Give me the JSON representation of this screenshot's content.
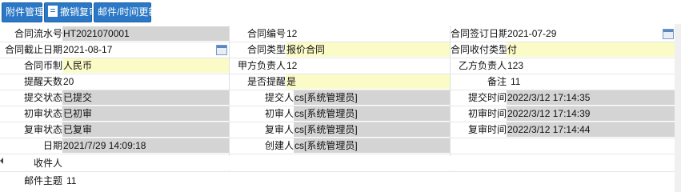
{
  "toolbar": {
    "attachment_label": "附件管理",
    "revoke_label": "撤销复审",
    "mail_label": "邮件/时间更新"
  },
  "fields": {
    "contract_serial_label": "合同流水号",
    "contract_serial_value": "HT2021070001",
    "contract_no_label": "合同编号",
    "contract_no_value": "12",
    "sign_date_label": "合同签订日期",
    "sign_date_value": "2021-07-29",
    "end_date_label": "合同截止日期",
    "end_date_value": "2021-08-17",
    "contract_type_label": "合同类型",
    "contract_type_value": "报价合同",
    "payment_type_label": "合同收付类型",
    "payment_type_value": "付",
    "currency_label": "合同币制",
    "currency_value": "人民币",
    "party_a_label": "甲方负责人",
    "party_a_value": "12",
    "party_b_label": "乙方负责人",
    "party_b_value": "123",
    "remind_days_label": "提醒天数",
    "remind_days_value": "20",
    "is_remind_label": "是否提醒",
    "is_remind_value": "是",
    "remark_label": "备注",
    "remark_value": "11",
    "submit_status_label": "提交状态",
    "submit_status_value": "已提交",
    "submitter_label": "提交人",
    "submitter_value": "cs[系统管理员]",
    "submit_time_label": "提交时间",
    "submit_time_value": "2022/3/12 17:14:35",
    "first_review_status_label": "初审状态",
    "first_review_status_value": "已初审",
    "first_reviewer_label": "初审人",
    "first_reviewer_value": "cs[系统管理员]",
    "first_review_time_label": "初审时间",
    "first_review_time_value": "2022/3/12 17:14:39",
    "second_review_status_label": "复审状态",
    "second_review_status_value": "已复审",
    "second_reviewer_label": "复审人",
    "second_reviewer_value": "cs[系统管理员]",
    "second_review_time_label": "复审时间",
    "second_review_time_value": "2022/3/12 17:14:44",
    "date_label": "日期",
    "date_value": "2021/7/29 14:09:18",
    "creator_label": "创建人",
    "creator_value": "cs[系统管理员]",
    "recipient_label": "收件人",
    "recipient_value": "",
    "mail_subject_label": "邮件主题",
    "mail_subject_value": "11"
  }
}
